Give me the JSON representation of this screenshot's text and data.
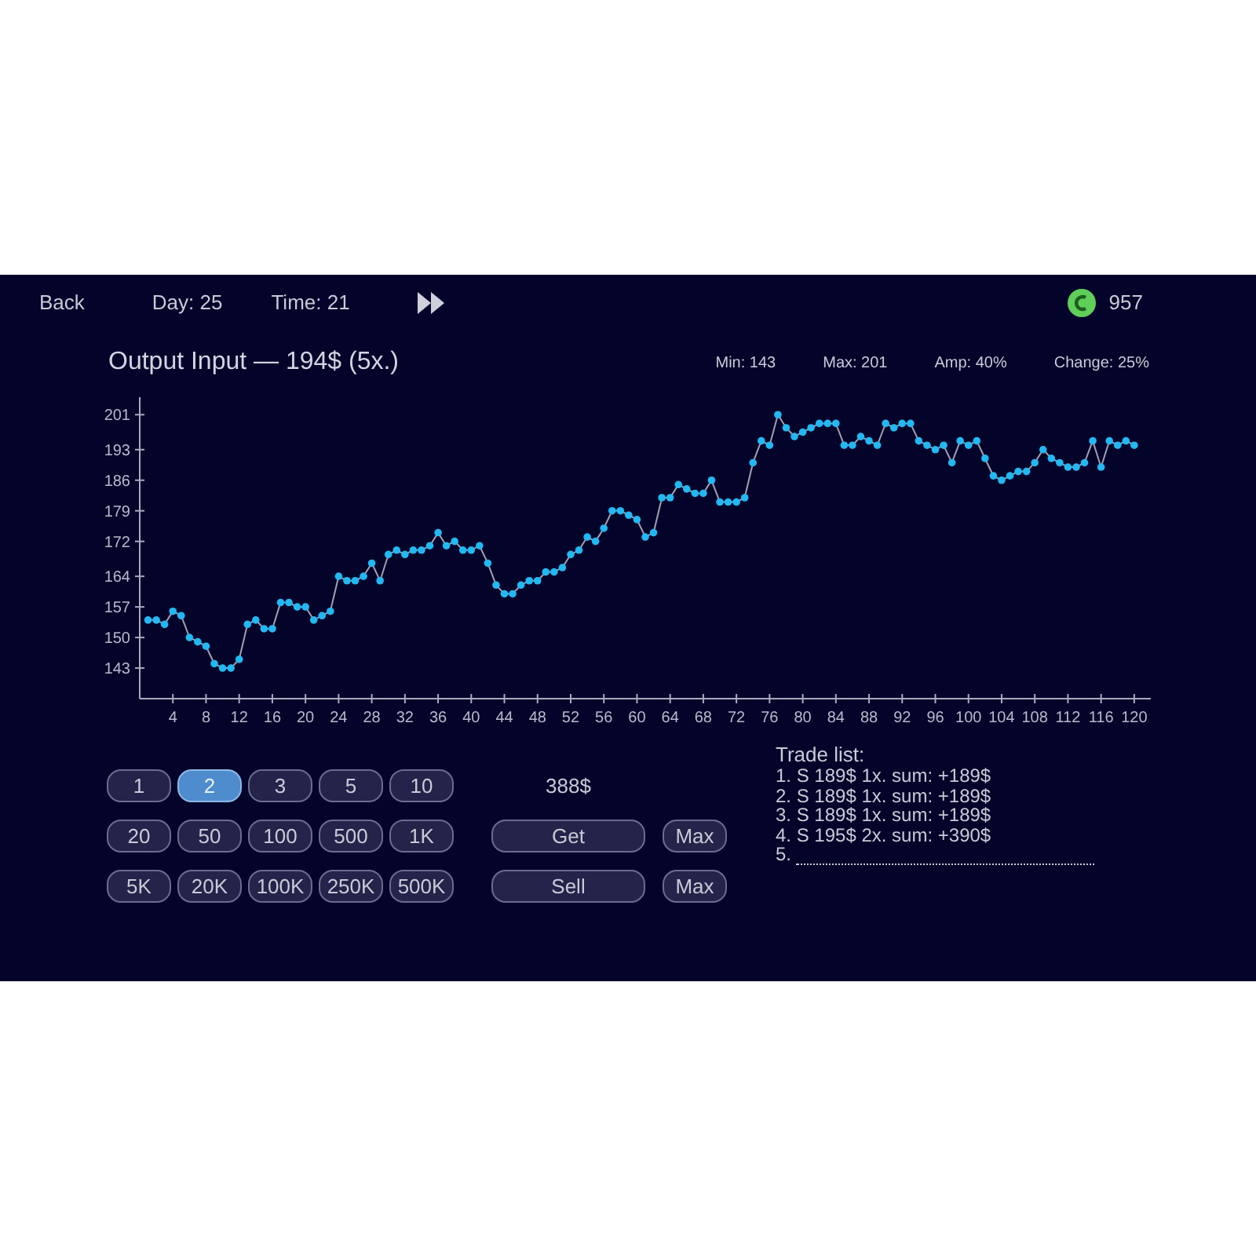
{
  "header": {
    "back": "Back",
    "day": "Day: 25",
    "time": "Time: 21",
    "coins": "957"
  },
  "title": "Output Input — 194$ (5x.)",
  "stats": [
    "Min: 143",
    "Max: 201",
    "Amp: 40%",
    "Change: 25%"
  ],
  "chart_data": {
    "type": "line",
    "xlim": [
      0,
      122
    ],
    "ylim": [
      136,
      205
    ],
    "xticks": [
      4,
      8,
      12,
      16,
      20,
      24,
      28,
      32,
      36,
      40,
      44,
      48,
      52,
      56,
      60,
      64,
      68,
      72,
      76,
      80,
      84,
      88,
      92,
      96,
      100,
      104,
      108,
      112,
      116,
      120
    ],
    "yticks": [
      143,
      150,
      157,
      164,
      172,
      179,
      186,
      193,
      201
    ],
    "x": [
      1,
      2,
      3,
      4,
      5,
      6,
      7,
      8,
      9,
      10,
      11,
      12,
      13,
      14,
      15,
      16,
      17,
      18,
      19,
      20,
      21,
      22,
      23,
      24,
      25,
      26,
      27,
      28,
      29,
      30,
      31,
      32,
      33,
      34,
      35,
      36,
      37,
      38,
      39,
      40,
      41,
      42,
      43,
      44,
      45,
      46,
      47,
      48,
      49,
      50,
      51,
      52,
      53,
      54,
      55,
      56,
      57,
      58,
      59,
      60,
      61,
      62,
      63,
      64,
      65,
      66,
      67,
      68,
      69,
      70,
      71,
      72,
      73,
      74,
      75,
      76,
      77,
      78,
      79,
      80,
      81,
      82,
      83,
      84,
      85,
      86,
      87,
      88,
      89,
      90,
      91,
      92,
      93,
      94,
      95,
      96,
      97,
      98,
      99,
      100,
      101,
      102,
      103,
      104,
      105,
      106,
      107,
      108,
      109,
      110,
      111,
      112,
      113,
      114,
      115,
      116,
      117,
      118,
      119,
      120
    ],
    "series": [
      {
        "marker": "circle",
        "color": "#22b8f2",
        "values": [
          154,
          154,
          153,
          156,
          155,
          150,
          149,
          148,
          144,
          143,
          143,
          145,
          153,
          154,
          152,
          152,
          158,
          158,
          157,
          157,
          154,
          155,
          156,
          164,
          163,
          163,
          164,
          167,
          163,
          169,
          170,
          169,
          170,
          170,
          171,
          174,
          171,
          172,
          170,
          170,
          171,
          167,
          162,
          160,
          160,
          162,
          163,
          163,
          165,
          165,
          166,
          169,
          170,
          173,
          172,
          175,
          179,
          179,
          178,
          177,
          173,
          174,
          182,
          182,
          185,
          184,
          183,
          183,
          186,
          181,
          181,
          181,
          182,
          190,
          195,
          194,
          201,
          198,
          196,
          197,
          198,
          199,
          199,
          199,
          194,
          194,
          196,
          195,
          194,
          199,
          198,
          199,
          199,
          195,
          194,
          193,
          194,
          190,
          195,
          194,
          195,
          191,
          187,
          186,
          187,
          188,
          188,
          190,
          193,
          191,
          190,
          189,
          189,
          190,
          195,
          189,
          195,
          194,
          195,
          194
        ]
      }
    ]
  },
  "amounts": [
    {
      "label": "1",
      "selected": false
    },
    {
      "label": "2",
      "selected": true
    },
    {
      "label": "3",
      "selected": false
    },
    {
      "label": "5",
      "selected": false
    },
    {
      "label": "10",
      "selected": false
    },
    {
      "label": "20",
      "selected": false
    },
    {
      "label": "50",
      "selected": false
    },
    {
      "label": "100",
      "selected": false
    },
    {
      "label": "500",
      "selected": false
    },
    {
      "label": "1K",
      "selected": false
    },
    {
      "label": "5K",
      "selected": false
    },
    {
      "label": "20K",
      "selected": false
    },
    {
      "label": "100K",
      "selected": false
    },
    {
      "label": "250K",
      "selected": false
    },
    {
      "label": "500K",
      "selected": false
    }
  ],
  "price": "388$",
  "actions": [
    {
      "label": "Get",
      "max": "Max"
    },
    {
      "label": "Sell",
      "max": "Max"
    }
  ],
  "trade_list": {
    "title": "Trade list:",
    "entries": [
      "1. S 189$ 1x. sum: +189$",
      "2. S 189$ 1x. sum: +189$",
      "3. S 189$ 1x. sum: +189$",
      "4. S 195$ 2x. sum: +390$"
    ],
    "next": "5."
  }
}
